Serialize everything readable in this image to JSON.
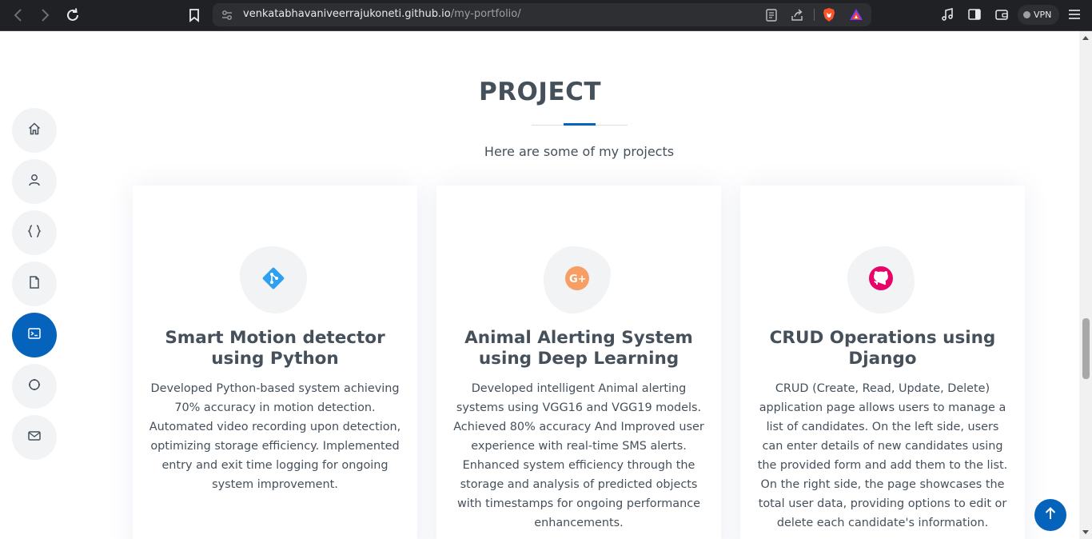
{
  "browser": {
    "url_host": "venkatabhavaniveerrajukoneti.github.io",
    "url_path": "/my-portfolio/",
    "vpn_label": "VPN"
  },
  "side_nav": {
    "items": [
      {
        "icon": "home-icon",
        "active": false
      },
      {
        "icon": "person-icon",
        "active": false
      },
      {
        "icon": "braces-icon",
        "active": false
      },
      {
        "icon": "file-icon",
        "active": false
      },
      {
        "icon": "terminal-icon",
        "active": true
      },
      {
        "icon": "circle-icon",
        "active": false
      },
      {
        "icon": "envelope-icon",
        "active": false
      }
    ]
  },
  "section": {
    "title": "PROJECT",
    "subtitle": "Here are some of my projects"
  },
  "projects": [
    {
      "icon": "git-icon",
      "icon_color": "#2f9ff0",
      "title": "Smart Motion detector using Python",
      "description": "Developed Python-based system achieving 70% accuracy in motion detection. Automated video recording upon detection, optimizing storage efficiency. Implemented entry and exit time logging for ongoing system improvement."
    },
    {
      "icon": "google-plus-icon",
      "icon_color": "#f79e65",
      "title": "Animal Alerting System using Deep Learning",
      "description": "Developed intelligent Animal alerting systems using VGG16 and VGG19 models. Achieved 80% accuracy And Improved user experience with real-time SMS alerts. Enhanced system efficiency through the storage and analysis of predicted objects with timestamps for ongoing performance enhancements."
    },
    {
      "icon": "github-icon",
      "icon_color": "#e80368",
      "title": "CRUD Operations using Django",
      "description": "CRUD (Create, Read, Update, Delete) application page allows users to manage a list of candidates. On the left side, users can enter details of new candidates using the provided form and add them to the list. On the right side, the page showcases the total user data, providing options to edit or delete each candidate's information."
    }
  ],
  "colors": {
    "accent": "#0563bb",
    "text": "#45505b"
  }
}
